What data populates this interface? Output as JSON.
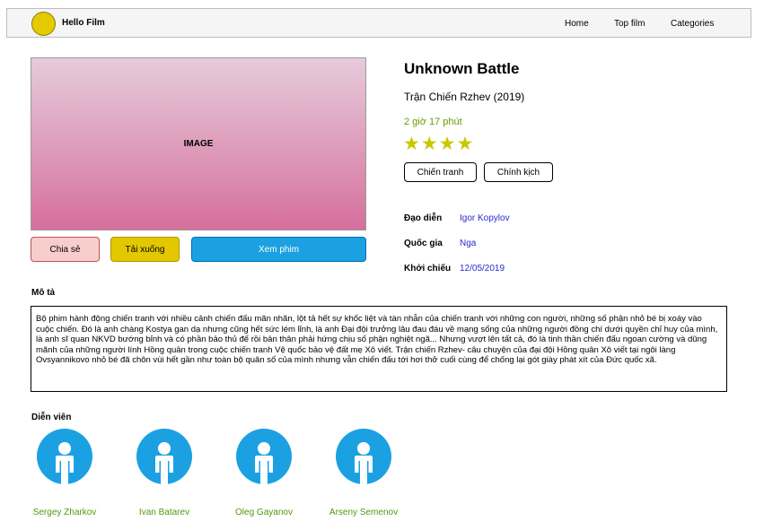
{
  "header": {
    "brand": "Hello Film",
    "nav": [
      "Home",
      "Top film",
      "Categories"
    ],
    "logo_color": "#e3cb00"
  },
  "poster": {
    "label": "IMAGE"
  },
  "actions": {
    "share": "Chia sẻ",
    "download": "Tải xuống",
    "watch": "Xem phim"
  },
  "movie": {
    "title": "Unknown Battle",
    "subtitle": "Trận Chiến Rzhev (2019)",
    "duration": "2 giờ 17 phút",
    "rating_stars": 4,
    "rating_text": "★★★★",
    "genres": [
      "Chiến tranh",
      "Chính kịch"
    ],
    "director_label": "Đạo diễn",
    "director": "Igor Kopylov",
    "country_label": "Quốc gia",
    "country": "Nga",
    "release_label": "Khởi chiếu",
    "release": "12/05/2019"
  },
  "description": {
    "title": "Mô tả",
    "text": "Bộ phim hành động chiến tranh với nhiều cảnh chiến đấu mãn nhãn, lột tả hết sự khốc liệt và tàn nhẫn của chiến tranh với những con người, những số phận nhỏ bé bị xoáy vào cuộc chiến. Đó là anh chàng Kostya gan dạ nhưng cũng hết sức lém lỉnh, là anh Đại đội trưởng lâu đau đáu về mạng sống của những người đồng chí dưới quyền chỉ huy của mình, là anh sĩ quan NKVD bướng bỉnh và có phần bảo thủ để rồi bản thân phải hứng chịu số phận nghiệt ngã... Nhưng vượt lên tất cả, đó là tinh thần chiến đấu ngoan cường và dũng mãnh của những người lính Hồng quân trong cuộc chiến tranh Vệ quốc bảo vệ đất mẹ Xô viết. Trận chiến Rzhev- câu chuyện của đại đội Hồng quân Xô viết tại ngôi làng Ovsyannikovo nhỏ bé đã chôn vùi hết gần như toàn bộ quân số của mình nhưng vẫn chiến đấu tới hơi thở cuối cùng để chống lại gót giày phát xít của Đức quốc xã."
  },
  "cast": {
    "title": "Diễn viên",
    "actors": [
      {
        "name": "Sergey Zharkov",
        "icon": "person-icon"
      },
      {
        "name": "Ivan Batarev",
        "icon": "person-icon"
      },
      {
        "name": "Oleg Gayanov",
        "icon": "person-icon"
      },
      {
        "name": "Arseny Semenov",
        "icon": "person-icon"
      }
    ]
  },
  "colors": {
    "accent_blue": "#1ba1e2",
    "share": "#f8cecc",
    "download": "#e3c800",
    "duration_green": "#6a9a00",
    "link_blue": "#2a2ad0",
    "actor_name_green": "#4d9a10"
  }
}
